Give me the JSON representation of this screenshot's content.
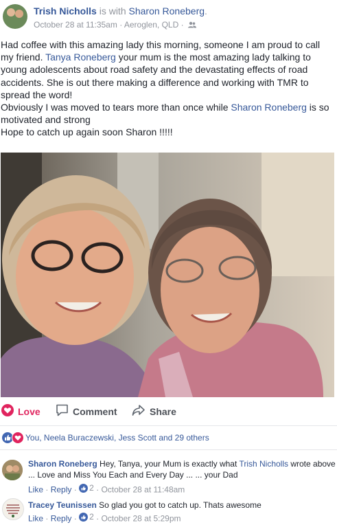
{
  "post": {
    "author": "Trish Nicholls",
    "with_text": "is with",
    "tagged": "Sharon Roneberg",
    "tagged_suffix": ".",
    "date": "October 28 at 11:35am",
    "separator": "·",
    "location": "Aeroglen, QLD",
    "separator2": "·",
    "privacy_icon": "friends-icon",
    "text": {
      "p1_a": "Had coffee with this amazing lady this morning, someone I am proud to call my friend. ",
      "p1_tag": "Tanya Roneberg",
      "p1_b": " your mum is the most amazing lady talking to young adolescents about road safety and the devastating effects of road accidents. She is out there making a difference and working with TMR to spread the word!",
      "p2_a": "Obviously I was moved to tears more than once while ",
      "p2_tag": "Sharon Roneberg",
      "p2_b": " is so motivated and strong",
      "p3": "Hope to catch up again soon Sharon !!!!!"
    }
  },
  "actions": {
    "love": "Love",
    "comment": "Comment",
    "share": "Share"
  },
  "reactions": {
    "text": "You, Neela Buraczewski, Jess Scott and 29 others"
  },
  "comments": [
    {
      "author": "Sharon Roneberg",
      "text_a": " Hey, Tanya, your Mum is exactly what ",
      "tag": "Trish Nicholls",
      "text_b": " wrote above ... Love and Miss You Each and Every Day ... ... your Dad",
      "like": "Like",
      "reply": "Reply",
      "likes": "2",
      "date": "October 28 at 11:48am"
    },
    {
      "author": "Tracey Teunissen",
      "text_a": " So glad you got to catch up. Thats awesome",
      "like": "Like",
      "reply": "Reply",
      "likes": "2",
      "date": "October 28 at 5:29pm"
    }
  ],
  "colors": {
    "link": "#365899",
    "love": "#e0245e",
    "meta": "#90949c",
    "like_blue": "#4267b2"
  }
}
